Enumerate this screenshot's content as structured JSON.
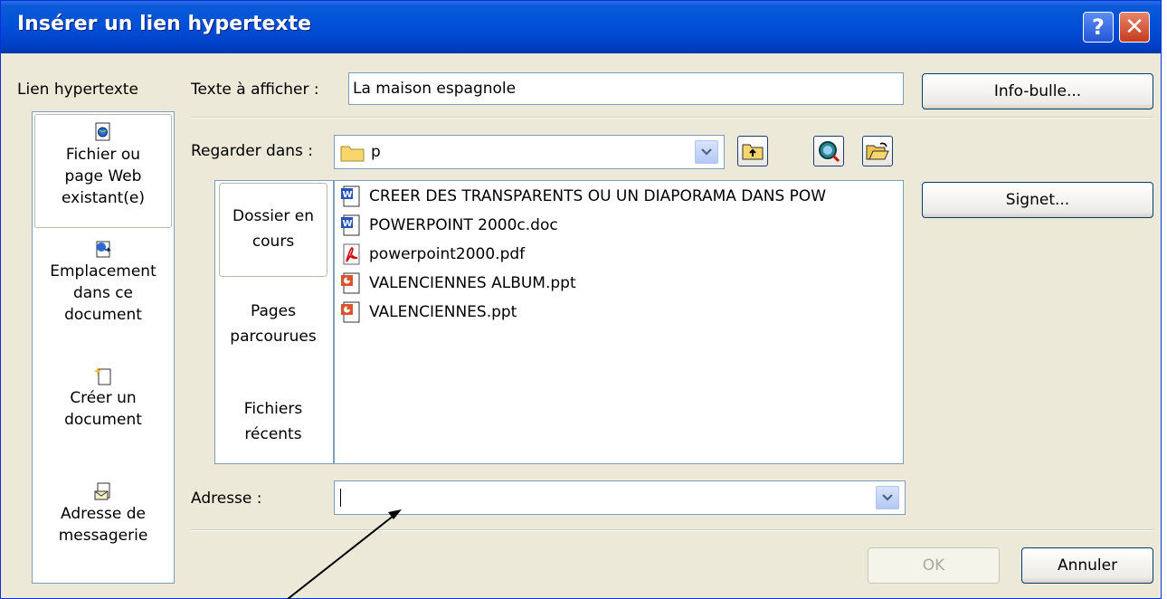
{
  "window": {
    "title": "Insérer un lien hypertexte",
    "help_glyph": "?",
    "close_glyph": "✕"
  },
  "left": {
    "label": "Lien hypertexte",
    "places": [
      {
        "line1": "Fichier ou",
        "line2": "page Web",
        "line3": "existant(e)",
        "icon": "web-file-icon"
      },
      {
        "line1": "Emplacement",
        "line2": "dans ce",
        "line3": "document",
        "icon": "document-place-icon"
      },
      {
        "line1": "Créer un",
        "line2": "document",
        "icon": "new-document-icon"
      },
      {
        "line1": "Adresse de",
        "line2": "messagerie",
        "icon": "email-address-icon"
      }
    ]
  },
  "text_display": {
    "label": "Texte à afficher :",
    "value": "La maison espagnole"
  },
  "buttons": {
    "tooltip": "Info-bulle...",
    "bookmark": "Signet...",
    "ok": "OK",
    "cancel": "Annuler"
  },
  "look_in": {
    "label": "Regarder dans :",
    "value": "p"
  },
  "tabs": [
    {
      "line1": "Dossier en",
      "line2": "cours"
    },
    {
      "line1": "Pages",
      "line2": "parcourues"
    },
    {
      "line1": "Fichiers",
      "line2": "récents"
    }
  ],
  "files": [
    {
      "name": "CREER DES TRANSPARENTS OU UN DIAPORAMA DANS POW",
      "icon": "word-doc-icon"
    },
    {
      "name": "POWERPOINT 2000c.doc",
      "icon": "word-doc-icon"
    },
    {
      "name": "powerpoint2000.pdf",
      "icon": "pdf-icon"
    },
    {
      "name": "VALENCIENNES ALBUM.ppt",
      "icon": "ppt-icon"
    },
    {
      "name": "VALENCIENNES.ppt",
      "icon": "ppt-icon"
    }
  ],
  "address": {
    "label": "Adresse :",
    "value": ""
  },
  "colors": {
    "title_bar": "#0050d8",
    "dialog_bg": "#ece9d8",
    "field_border": "#7f9db9"
  }
}
